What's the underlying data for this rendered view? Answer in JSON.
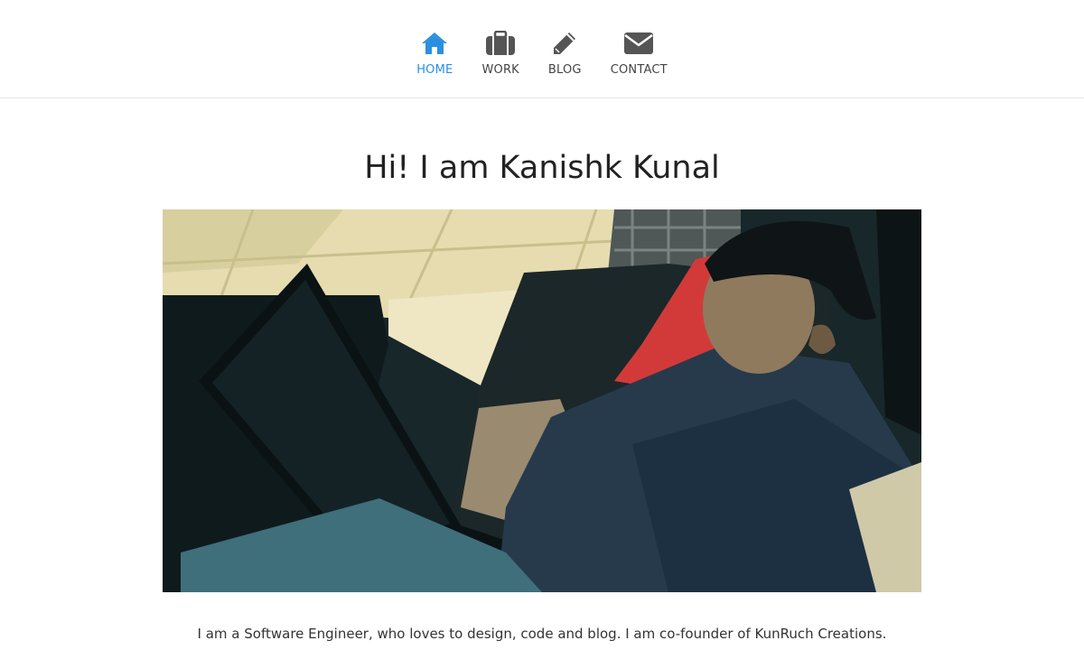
{
  "nav": {
    "items": [
      {
        "label": "HOME",
        "icon": "home-icon",
        "active": true
      },
      {
        "label": "WORK",
        "icon": "briefcase-icon",
        "active": false
      },
      {
        "label": "BLOG",
        "icon": "pencil-icon",
        "active": false
      },
      {
        "label": "CONTACT",
        "icon": "envelope-icon",
        "active": false
      }
    ]
  },
  "colors": {
    "accent": "#2b8fe0",
    "nav_icon": "#555555",
    "title": "#222222"
  },
  "main": {
    "title": "Hi! I am Kanishk Kunal",
    "hero_image": "photo-of-man-with-laptop",
    "intro_line": "I am a Software Engineer, who loves to design, code and blog. I am co-founder of KunRuch Creations."
  }
}
